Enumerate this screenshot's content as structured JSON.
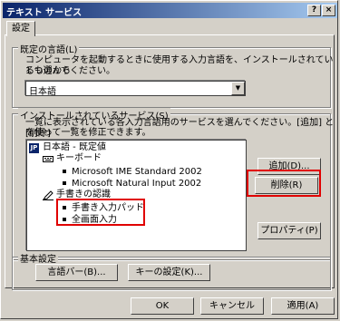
{
  "window": {
    "title": "テキスト サービス",
    "help_label": "?",
    "close_label": "×"
  },
  "tab": {
    "label": "設定"
  },
  "default_lang": {
    "group_label": "既定の言語(L)",
    "description_1": "コンピュータを起動するときに使用する入力言語を、インストールされているものから",
    "description_2": "1 つ選んでください。",
    "selected": "日本語"
  },
  "installed": {
    "group_label": "インストールされているサービス(S)",
    "description_1": "一覧に表示されている各入力言語用のサービスを選んでください。[追加] と [削除]",
    "description_2": "を使って一覧を修正できます。",
    "tree": {
      "root_icon": "JP",
      "root": "日本語 - 既定値",
      "keyboard": "キーボード",
      "ime1": "Microsoft IME Standard 2002",
      "ime2": "Microsoft Natural Input 2002",
      "handwriting": "手書きの認識",
      "hw1": "手書き入力パッド",
      "hw2": "全画面入力"
    },
    "buttons": {
      "add": "追加(D)...",
      "remove": "削除(R)",
      "properties": "プロパティ(P)"
    }
  },
  "basic": {
    "group_label": "基本設定",
    "language_bar": "言語バー(B)...",
    "key_settings": "キーの設定(K)..."
  },
  "footer": {
    "ok": "OK",
    "cancel": "キャンセル",
    "apply": "適用(A)"
  },
  "colors": {
    "highlight": "#e00000",
    "titlebar_start": "#0a246a",
    "titlebar_end": "#a6caf0"
  },
  "icons": [
    "keyboard-icon",
    "pen-icon",
    "jp-language-icon"
  ]
}
